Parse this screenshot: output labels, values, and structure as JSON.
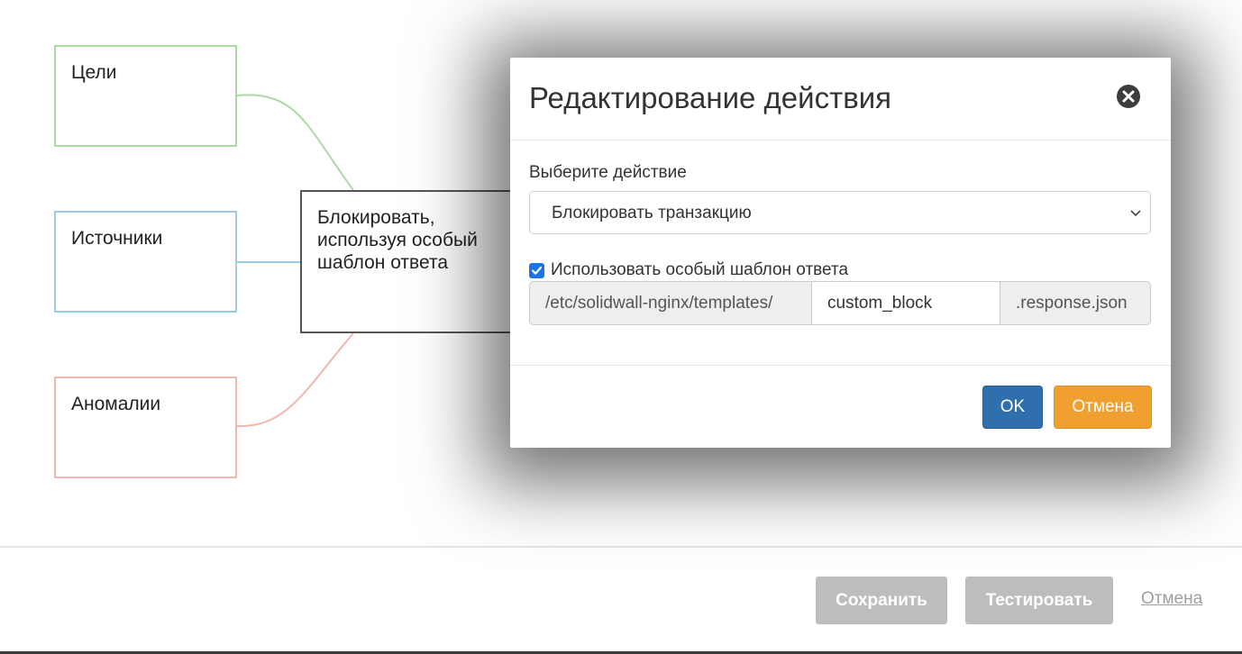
{
  "diagram": {
    "nodes": {
      "goals": "Цели",
      "sources": "Источники",
      "anomalies": "Аномалии",
      "action": "Блокировать, используя особый шаблон ответа"
    }
  },
  "footer": {
    "save_label": "Сохранить",
    "test_label": "Тестировать",
    "cancel_label": "Отмена"
  },
  "modal": {
    "title": "Редактирование действия",
    "action_label": "Выберите действие",
    "action_value": "Блокировать транзакцию",
    "use_template_label": "Использовать особый шаблон ответа",
    "use_template_checked": true,
    "template_prefix": "/etc/solidwall-nginx/templates/",
    "template_name": "custom_block",
    "template_suffix": ".response.json",
    "ok_label": "OK",
    "cancel_label": "Отмена"
  },
  "colors": {
    "goals_border": "#a9dba0",
    "sources_border": "#9dcde2",
    "anomalies_border": "#f0b7b1",
    "ok_button": "#2f6fae",
    "cancel_button": "#f0a030",
    "disabled_button": "#bdbdbd"
  },
  "icons": [
    "close-icon",
    "chevron-down-icon",
    "check-icon"
  ]
}
